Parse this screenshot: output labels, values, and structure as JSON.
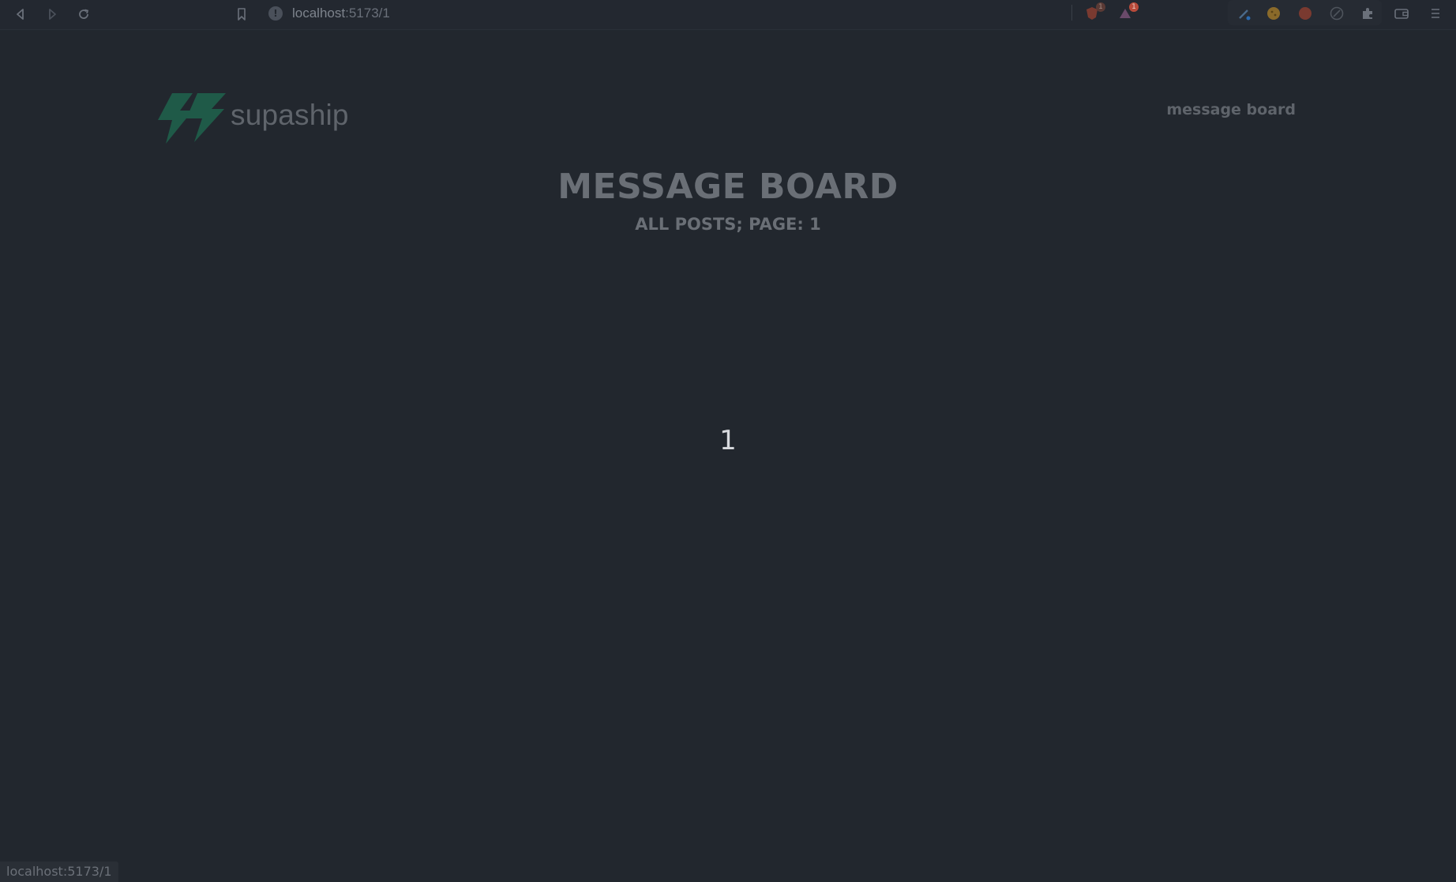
{
  "browser": {
    "url_host": "localhost",
    "url_rest": ":5173/1",
    "info_icon": "info-icon",
    "shields_badge": "1",
    "alerts_badge": "1"
  },
  "site": {
    "brand": "supaship",
    "nav_link": "message board",
    "accent": "#1f5a48"
  },
  "main": {
    "title": "Message Board",
    "subtitle": "All Posts; page: 1",
    "page_number": "1"
  },
  "status": {
    "hover_url": "localhost:5173/1"
  }
}
